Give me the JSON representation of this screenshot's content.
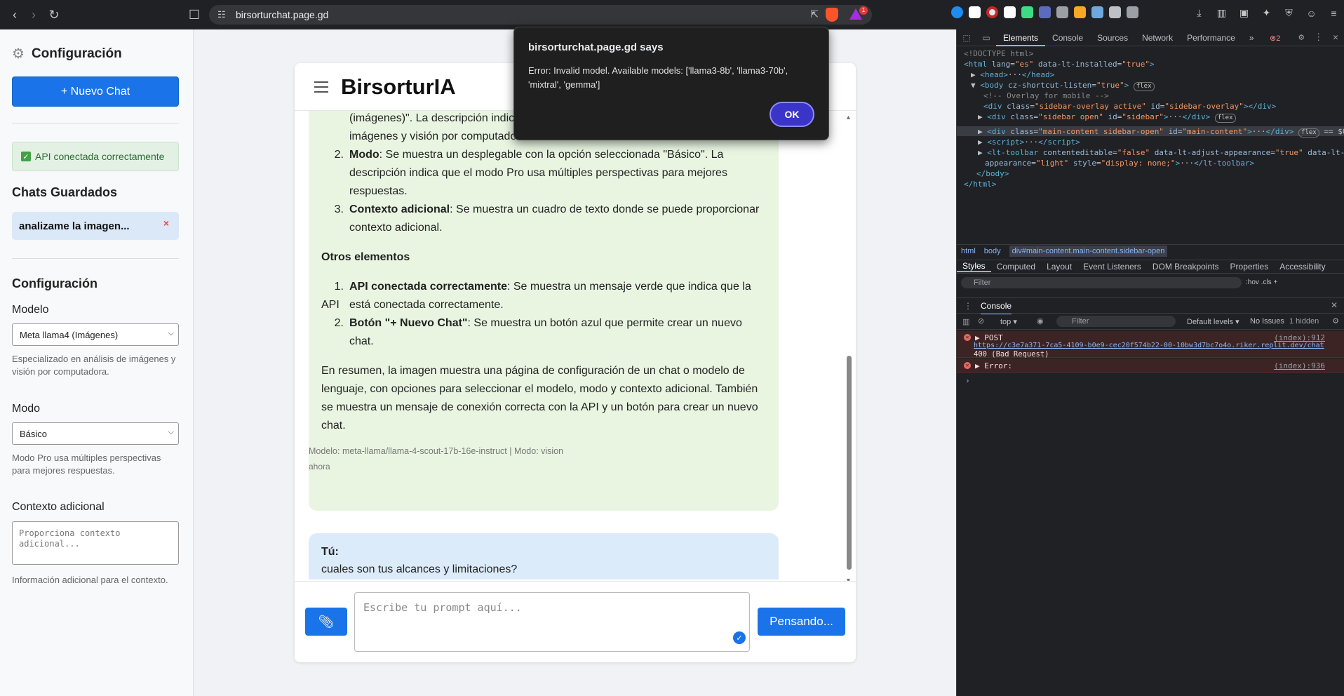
{
  "browser": {
    "url": "birsorturchat.page.gd",
    "rewards_badge": "1"
  },
  "sidebar": {
    "title": "Configuración",
    "new_chat": "+ Nuevo Chat",
    "api_status": "API conectada correctamente",
    "saved_title": "Chats Guardados",
    "saved_chats": [
      {
        "label": "analizame la imagen...",
        "delete": "×"
      }
    ],
    "config_title": "Configuración",
    "model_label": "Modelo",
    "model_value": "Meta llama4 (Imágenes)",
    "model_help": "Especializado en análisis de imágenes y visión por computadora.",
    "mode_label": "Modo",
    "mode_value": "Básico",
    "mode_help": "Modo Pro usa múltiples perspectivas para mejores respuestas.",
    "context_label": "Contexto adicional",
    "context_placeholder": "Proporciona contexto adicional...",
    "context_help": "Información adicional para el contexto."
  },
  "chat": {
    "brand": "BirsorturIA",
    "bot_lines": {
      "l0": "(imágenes)\". La descripción indica",
      "l1": "imágenes y visión por computado",
      "l2_num": "2.",
      "l2_bold": "Modo",
      "l2_rest": ": Se muestra un desplegable con la opción seleccionada \"Básico\". La",
      "l3": "descripción indica que el modo Pro usa múltiples perspectivas para mejores",
      "l4": "respuestas.",
      "l5_num": "3.",
      "l5_bold": "Contexto adicional",
      "l5_rest": ": Se muestra un cuadro de texto donde se puede proporcionar",
      "l6": "contexto adicional.",
      "others": "Otros elementos",
      "l7_num": "1.",
      "l7_bold": "API conectada correctamente",
      "l7_rest": ": Se muestra un mensaje verde que indica que la API",
      "l8": "está conectada correctamente.",
      "l9_num": "2.",
      "l9_bold": "Botón \"+ Nuevo Chat\"",
      "l9_rest": ": Se muestra un botón azul que permite crear un nuevo",
      "l10": "chat.",
      "summary": [
        "En resumen, la imagen muestra una página de configuración de un chat o modelo de",
        "lenguaje, con opciones para seleccionar el modelo, modo y contexto adicional. También",
        "se muestra un mensaje de conexión correcta con la API y un botón para crear un nuevo",
        "chat."
      ]
    },
    "bot_meta": "Modelo: meta-llama/llama-4-scout-17b-16e-instruct | Modo: vision",
    "bot_time": "ahora",
    "user_label": "Tú:",
    "user_text": "cuales son tus alcances y limitaciones?",
    "user_time": "ahora",
    "prompt_placeholder": "Escribe tu prompt aquí...",
    "send_label": "Pensando..."
  },
  "alert": {
    "title": "birsorturchat.page.gd says",
    "message": "Error: Invalid model. Available models: ['llama3-8b', 'llama3-70b', 'mixtral', 'gemma']",
    "ok": "OK"
  },
  "devtools": {
    "tabs": [
      "Elements",
      "Console",
      "Sources",
      "Network",
      "Performance"
    ],
    "error_count": "2",
    "breadcrumbs": [
      "html",
      "body",
      "div#main-content.main-content.sidebar-open"
    ],
    "style_tabs": [
      "Styles",
      "Computed",
      "Layout",
      "Event Listeners",
      "DOM Breakpoints",
      "Properties",
      "Accessibility"
    ],
    "filter": "Filter",
    "console_title": "Console",
    "console_toolbar": {
      "context": "top",
      "filter": "Filter",
      "levels": "Default levels",
      "issues": "No Issues",
      "hidden": "1 hidden"
    },
    "errors": [
      {
        "head": "POST",
        "url": "https://c3e7a371-7ca5-4109-b0e9-cec20f574b22-00-10bw3d7bc7o4o.riker.replit.dev/chat",
        "status": "400 (Bad Request)",
        "src": "(index):912"
      },
      {
        "head": "Error:",
        "src": "(index):936"
      }
    ]
  }
}
